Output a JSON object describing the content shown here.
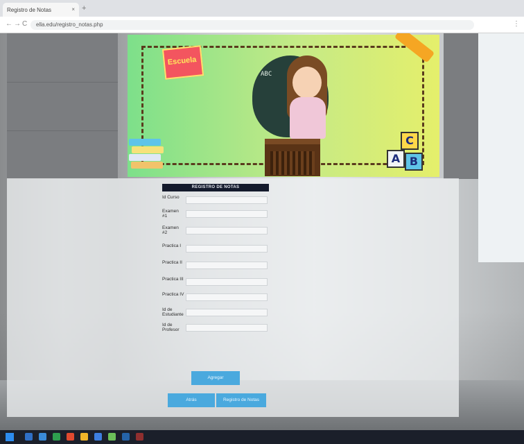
{
  "browser": {
    "tab_title": "Registro de Notas",
    "tab_close": "×",
    "new_tab": "+",
    "url": "ella.edu/registro_notas.php",
    "back": "←",
    "forward": "→",
    "reload": "C",
    "menu": "⋮"
  },
  "banner": {
    "logo_text": "Escuela",
    "board_text": "ABC",
    "blocks": [
      "A",
      "B",
      "C"
    ]
  },
  "form": {
    "title": "REGISTRO DE NOTAS",
    "fields": [
      {
        "label": "Id Curso",
        "value": ""
      },
      {
        "label": "Examen #1",
        "value": ""
      },
      {
        "label": "Examen #2",
        "value": ""
      },
      {
        "label": "Practica I",
        "value": ""
      },
      {
        "label": "Practica II",
        "value": ""
      },
      {
        "label": "Practica III",
        "value": ""
      },
      {
        "label": "Practica IV",
        "value": ""
      },
      {
        "label": "Id de Estudiante",
        "value": ""
      },
      {
        "label": "Id de Profesor",
        "value": ""
      }
    ],
    "register_button": "Agregar",
    "back_button": "Atrás",
    "students_button": "Registro de Notas"
  },
  "colors": {
    "accent_button": "#4aa9de",
    "title_bar": "#141a2c",
    "banner_green": "#7de08a",
    "banner_yellow": "#e5ef6b"
  }
}
